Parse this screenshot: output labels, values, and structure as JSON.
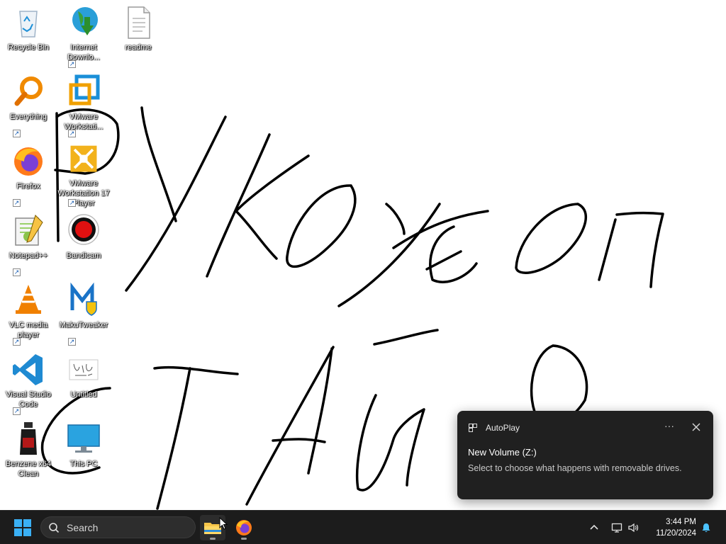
{
  "desktop": {
    "icons": [
      {
        "label": "Recycle Bin"
      },
      {
        "label": "Internet Downlo..."
      },
      {
        "label": "readme"
      },
      {
        "label": "Everything"
      },
      {
        "label": "VMware Workstati..."
      },
      {
        "label": "Firefox"
      },
      {
        "label": "VMware Workstation 17 Player"
      },
      {
        "label": "Notepad++"
      },
      {
        "label": "Bandicam"
      },
      {
        "label": "VLC media player"
      },
      {
        "label": "MakuTweaker"
      },
      {
        "label": "Visual Studio Code"
      },
      {
        "label": "Untitled"
      },
      {
        "label": "Benzene x64 Clean"
      },
      {
        "label": "This PC"
      }
    ]
  },
  "notification": {
    "app_name": "AutoPlay",
    "more_label": "···",
    "title": "New Volume (Z:)",
    "body": "Select to choose what happens with removable drives."
  },
  "taskbar": {
    "search_placeholder": "Search",
    "clock_time": "3:44 PM",
    "clock_date": "11/20/2024"
  },
  "colors": {
    "taskbar_bg": "#1c1c1c",
    "toast_bg": "#202020",
    "accent": "#0078d4",
    "ink": "#000000"
  }
}
